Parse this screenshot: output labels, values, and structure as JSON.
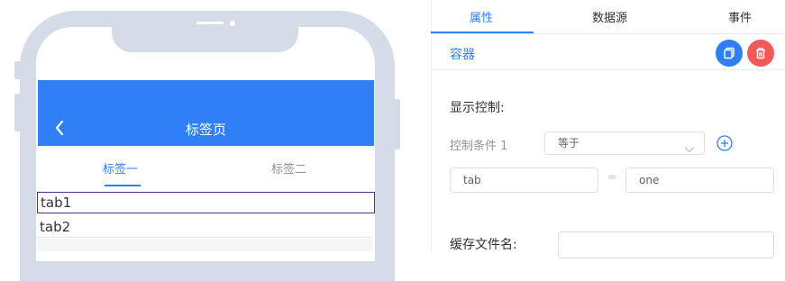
{
  "preview": {
    "nav_back_icon": "chevron-left-icon",
    "nav_title": "标签页",
    "tabs": [
      {
        "label": "标签一",
        "active": true
      },
      {
        "label": "标签二",
        "active": false
      }
    ],
    "rows": [
      "tab1",
      "tab2",
      ""
    ]
  },
  "panel": {
    "tabs": [
      {
        "label": "属性",
        "active": true
      },
      {
        "label": "数据源",
        "active": false
      },
      {
        "label": "事件",
        "active": false
      }
    ],
    "section_title": "容器",
    "copy_icon": "copy-icon",
    "delete_icon": "trash-icon",
    "display_control_label": "显示控制:",
    "condition_label": "控制条件 1",
    "condition_operator": "等于",
    "add_condition_icon": "plus-circle-icon",
    "condition_left_value": "tab",
    "equals_sign": "=",
    "condition_right_value": "one",
    "cache_filename_label": "缓存文件名:",
    "cache_filename_value": ""
  },
  "colors": {
    "accent": "#2f80f7",
    "danger": "#f25a5a",
    "phone_frame": "#d6dbe8",
    "selection_border": "#5b2d8e"
  }
}
